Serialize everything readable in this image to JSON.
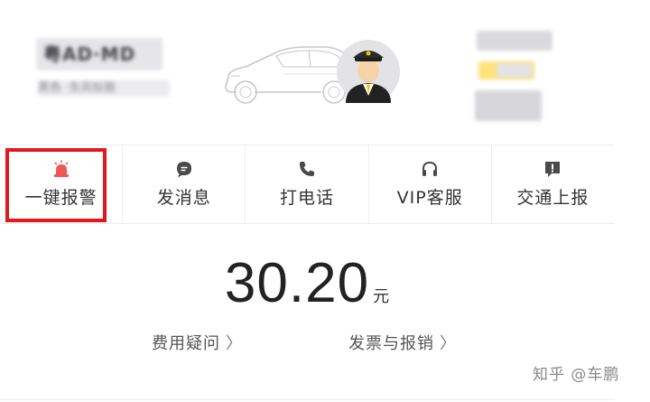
{
  "driver": {
    "plate": "粤AD·MD",
    "car_model": "黑色 ·东风标致"
  },
  "actions": [
    {
      "label": "一键报警",
      "icon": "alarm-siren-icon",
      "color": "#f25656"
    },
    {
      "label": "发消息",
      "icon": "chat-bubble-icon",
      "color": "#4a4a4a"
    },
    {
      "label": "打电话",
      "icon": "phone-icon",
      "color": "#4a4a4a"
    },
    {
      "label": "VIP客服",
      "icon": "headset-icon",
      "color": "#4a4a4a"
    },
    {
      "label": "交通上报",
      "icon": "report-alert-icon",
      "color": "#4a4a4a"
    }
  ],
  "fare": {
    "amount": "30.20",
    "unit": "元",
    "links": {
      "fee_question": "费用疑问",
      "invoice": "发票与报销"
    }
  },
  "watermark": "知乎 @车鹏",
  "colors": {
    "highlight": "#e0191e",
    "alarm": "#f25656"
  }
}
